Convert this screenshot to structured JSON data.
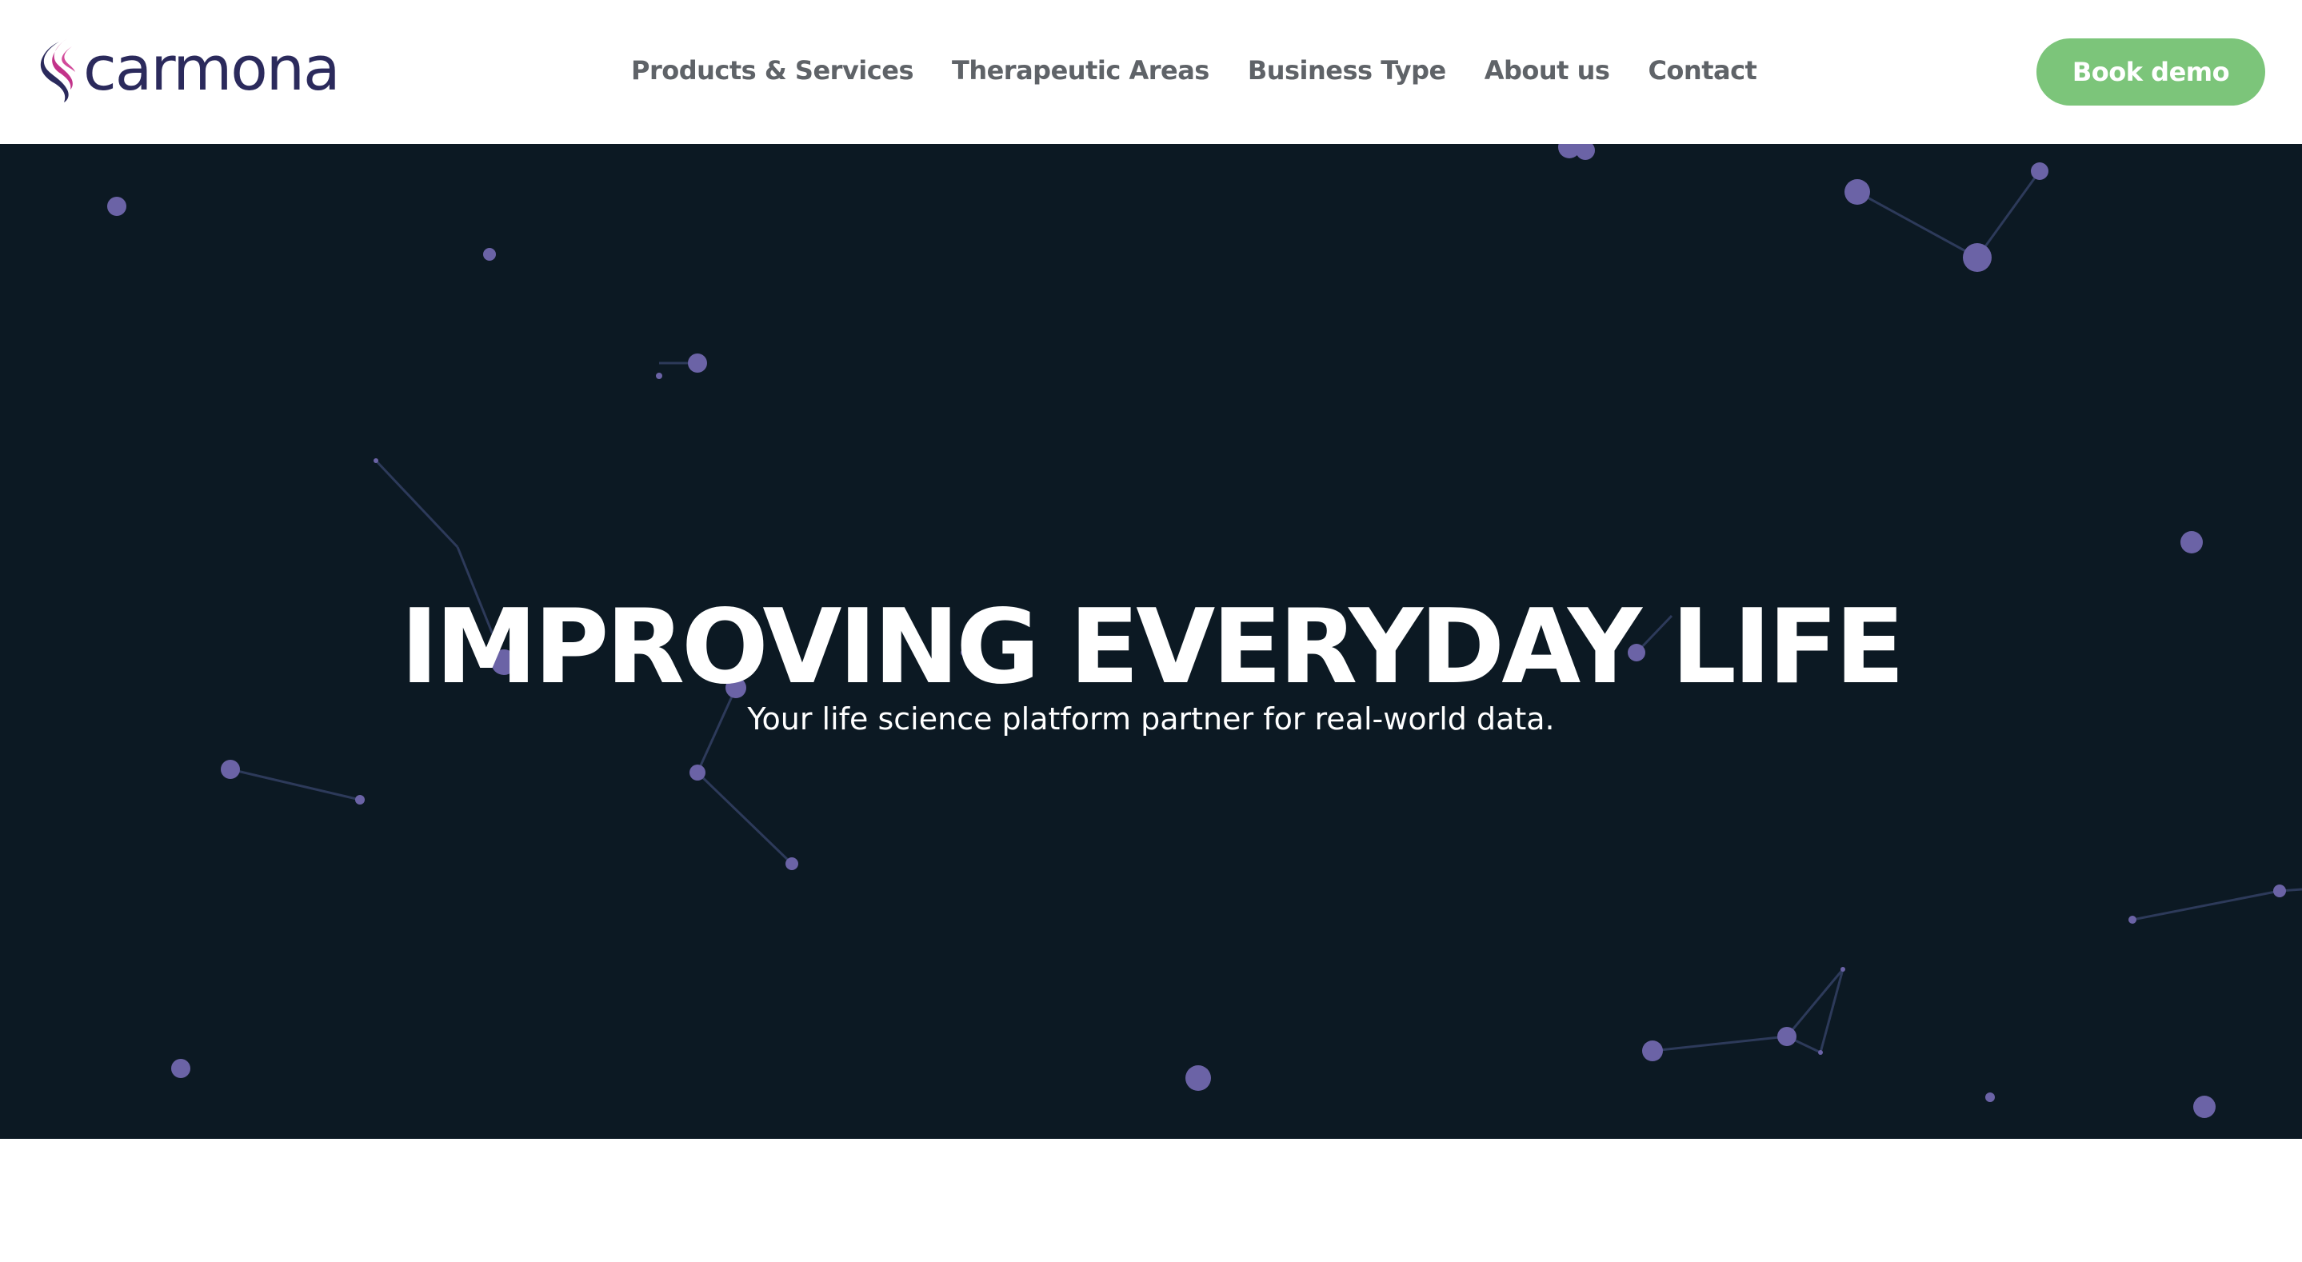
{
  "header": {
    "logo_text": "carmona",
    "nav": [
      {
        "label": "Products & Services"
      },
      {
        "label": "Therapeutic Areas"
      },
      {
        "label": "Business Type"
      },
      {
        "label": "About us"
      },
      {
        "label": "Contact"
      }
    ],
    "cta_label": "Book demo"
  },
  "hero": {
    "title": "IMPROVING EVERYDAY LIFE",
    "subtitle": "Your life science platform partner for real-world data."
  },
  "colors": {
    "brand_navy": "#2b2a5c",
    "brand_magenta": "#c2338a",
    "cta_green": "#7cc57a",
    "hero_background": "#0c1923",
    "particle": "#6b63a6",
    "nav_text": "#5f6368"
  },
  "icons": {
    "logo_mark": "carmona-flame-logo-icon"
  }
}
